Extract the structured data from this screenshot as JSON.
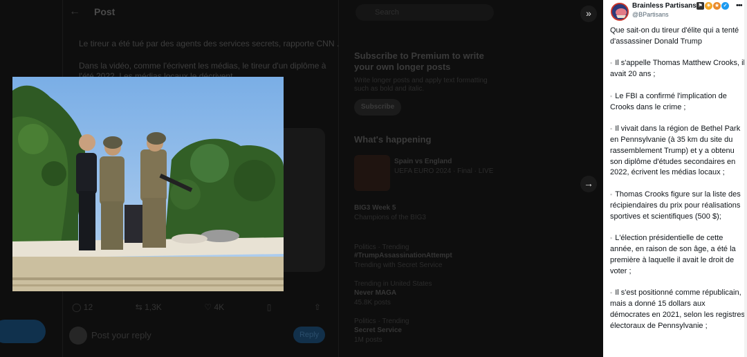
{
  "background": {
    "header_title": "Post",
    "lines": [
      "Le tireur a été tué par des agents des services secrets, rapporte CNN .",
      "Dans la vidéo, comme l'écrivent les médias, le tireur d'un diplôme à",
      "l'été 2022. Les médias locaux le décrivent"
    ],
    "actions": [
      "12",
      "1,3K",
      "4K",
      "",
      ""
    ],
    "reply_placeholder": "Post your reply",
    "reply_button": "Reply",
    "search_placeholder": "Search",
    "subscribe_title": "Subscribe to Premium to write your own longer posts",
    "subscribe_text": "Write longer posts and apply text formatting such as bold and italic.",
    "subscribe_button": "Subscribe",
    "whats_happening": "What's happening",
    "trend_card_title": "Spain vs England",
    "trend_card_sub": "UEFA EURO 2024 · Final · LIVE",
    "trends": [
      {
        "meta": "",
        "name": "BIG3 Week 5",
        "count": "Champions of the BIG3"
      },
      {
        "meta": "Politics · Trending",
        "name": "#TrumpAssassinationAttempt",
        "count": "Trending with Secret Service"
      },
      {
        "meta": "Trending in United States",
        "name": "Never MAGA",
        "count": "45.8K posts"
      },
      {
        "meta": "Politics · Trending",
        "name": "Secret Service",
        "count": "1M posts"
      }
    ]
  },
  "panel": {
    "name": "Brainless Partisans",
    "handle": "@BPartisans",
    "more_icon": "more-icon",
    "intro": "Que sait-on du tireur d'élite qui a tenté d'assassiner Donald Trump",
    "bullets": [
      "Il s'appelle Thomas Matthew Crooks, il avait 20 ans ;",
      "Le FBI a confirmé l'implication de Crooks dans le crime ;",
      "Il vivait dans la région de Bethel Park en Pennsylvanie (à 35 km du site du rassemblement Trump) et y a obtenu son diplôme d'études secondaires en 2022, écrivent les médias locaux ;",
      "Thomas Crooks figure sur la liste des récipiendaires du prix pour réalisations sportives et scientifiques (500 $);",
      "L'élection présidentielle de cette année, en raison de son âge, a été la première à laquelle il avait le droit de voter ;",
      "Il s'est positionné comme républicain, mais a donné 15 dollars aux démocrates en 2021, selon les registres électoraux de Pennsylvanie ;"
    ],
    "bullet_icon": "▪"
  },
  "nav": {
    "collapse": "»",
    "next": "→"
  },
  "colors": {
    "accent": "#1d9bf0",
    "panel_bg": "#ffffff",
    "backdrop": "#000000"
  }
}
